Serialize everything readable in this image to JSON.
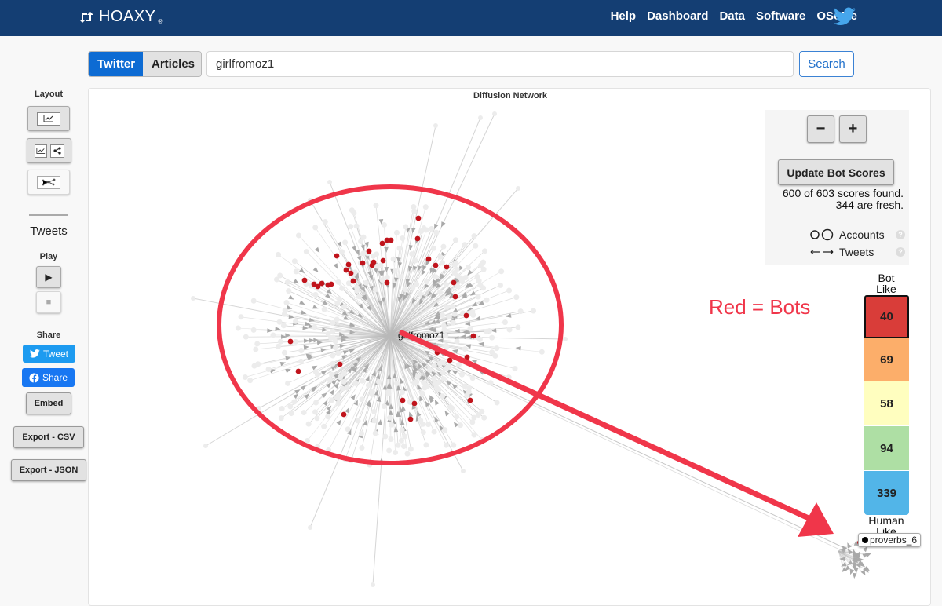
{
  "header": {
    "brand": "HOAXY",
    "brand_mark": "®",
    "nav": [
      "Help",
      "Dashboard",
      "Data",
      "Software",
      "OSoMe"
    ],
    "social_icon": "twitter-bird-icon"
  },
  "search": {
    "tabs": [
      {
        "label": "Twitter",
        "active": true
      },
      {
        "label": "Articles",
        "active": false
      }
    ],
    "query": "girlfromoz1",
    "button_label": "Search"
  },
  "sidebar": {
    "layout_label": "Layout",
    "layout_buttons": [
      "timeline-layout",
      "split-layout",
      "network-layout"
    ],
    "tweets_label": "Tweets",
    "play_label": "Play",
    "play_icon": "▶",
    "stop_icon": "■",
    "share_label": "Share",
    "tweet_button": "Tweet",
    "facebook_share_button": "Share",
    "embed_button": "Embed",
    "export_csv_button": "Export - CSV",
    "export_json_button": "Export - JSON"
  },
  "graph": {
    "title": "Diffusion Network",
    "center_account": "girlfromoz1",
    "highlighted_account": "proverbs_6",
    "colors": {
      "edge": "#b9b9b9",
      "node": "#ececec",
      "bot_node": "#c0141c",
      "annotation": "#f0364a"
    }
  },
  "controls": {
    "zoom_out": "−",
    "zoom_in": "+",
    "update_button": "Update Bot Scores",
    "scores_found": "600 of 603 scores found.",
    "scores_fresh": "344 are fresh.",
    "legend_accounts": "Accounts",
    "legend_tweets": "Tweets",
    "help_glyph": "?"
  },
  "bot_scale": {
    "top_label": [
      "Bot",
      "Like"
    ],
    "bottom_label": [
      "Human",
      "Like"
    ],
    "bins": [
      {
        "count": "40",
        "color": "#d93d39",
        "selected": true
      },
      {
        "count": "69",
        "color": "#fcae6a"
      },
      {
        "count": "58",
        "color": "#fffebf"
      },
      {
        "count": "94",
        "color": "#aedfa4"
      },
      {
        "count": "339",
        "color": "#52b5e8"
      }
    ]
  },
  "annotation": {
    "text": "Red = Bots"
  }
}
